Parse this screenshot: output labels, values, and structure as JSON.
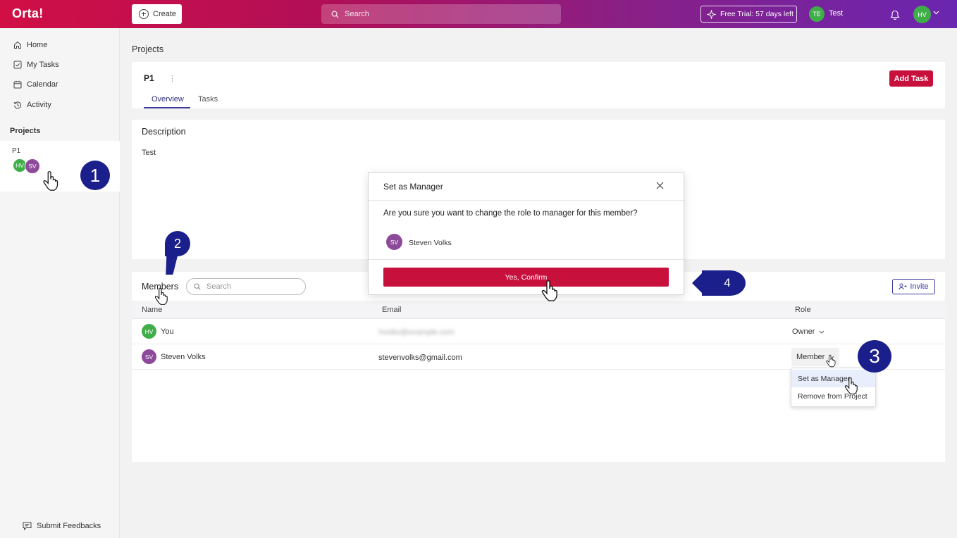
{
  "app": {
    "logo": "Orta!"
  },
  "topbar": {
    "create_label": "Create",
    "search_placeholder": "Search",
    "trial_label": "Free Trial: 57 days left",
    "workspace_initials": "TE",
    "workspace_name": "Test",
    "user_initials": "HV"
  },
  "sidebar": {
    "items": [
      {
        "label": "Home",
        "icon": "home-icon"
      },
      {
        "label": "My Tasks",
        "icon": "checkbox-icon"
      },
      {
        "label": "Calendar",
        "icon": "calendar-icon"
      },
      {
        "label": "Activity",
        "icon": "history-icon"
      }
    ],
    "projects_heading": "Projects",
    "project": {
      "name": "P1",
      "avatars": [
        "HV",
        "SV"
      ]
    },
    "feedback_label": "Submit Feedbacks"
  },
  "main": {
    "page_title": "Projects",
    "project_title": "P1",
    "kebab": "⋮",
    "tabs": [
      {
        "label": "Overview",
        "active": true
      },
      {
        "label": "Tasks",
        "active": false
      }
    ],
    "add_task_label": "Add Task",
    "description": {
      "title": "Description",
      "text": "Test"
    },
    "members": {
      "title": "Members",
      "search_placeholder": "Search",
      "invite_label": "Invite",
      "columns": [
        "Name",
        "Email",
        "Role"
      ],
      "rows": [
        {
          "initials": "HV",
          "name": "You",
          "email": "hvolks@example.com",
          "role": "Owner"
        },
        {
          "initials": "SV",
          "name": "Steven Volks",
          "email": "stevenvolks@gmail.com",
          "role": "Member"
        }
      ],
      "role_menu": [
        "Set as Manager",
        "Remove from Project"
      ]
    }
  },
  "modal": {
    "title": "Set as Manager",
    "question": "Are you sure you want to change the role to manager for this member?",
    "member_initials": "SV",
    "member_name": "Steven Volks",
    "confirm_label": "Yes, Confirm"
  },
  "markers": [
    "1",
    "2",
    "3",
    "4"
  ],
  "colors": {
    "brand_red": "#c8103d",
    "accent_indigo": "#3a3a9a",
    "marker_blue": "#1a1f8c"
  }
}
